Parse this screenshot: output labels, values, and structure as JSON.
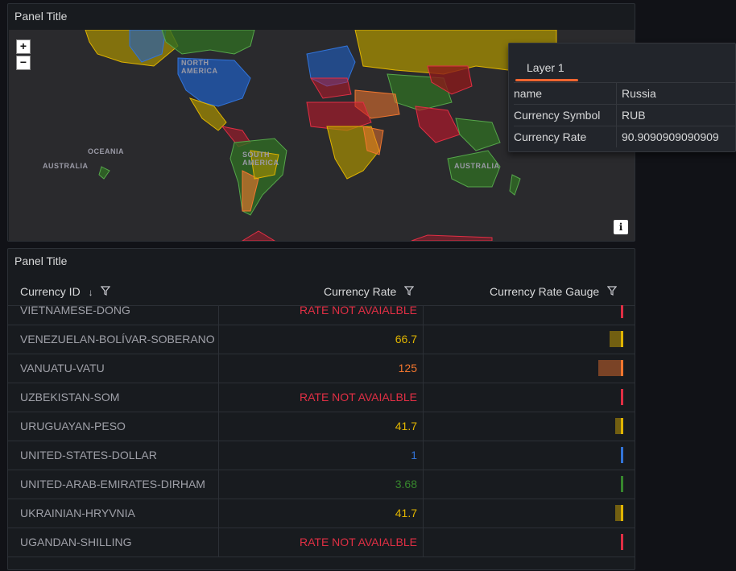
{
  "map_panel": {
    "title": "Panel Title",
    "zoom_in_label": "+",
    "zoom_out_label": "−",
    "info_label": "i",
    "region_labels": {
      "north_america": "NORTH\nAMERICA",
      "oceania": "OCEANIA",
      "australia_left": "AUSTRALIA",
      "south_america": "SOUTH\nAMERICA",
      "australia_right": "AUSTRALIA"
    }
  },
  "tooltip": {
    "tab_label": "Layer 1",
    "rows": [
      {
        "key": "name",
        "value": "Russia"
      },
      {
        "key": "Currency Symbol",
        "value": "RUB"
      },
      {
        "key": "Currency Rate",
        "value": "90.9090909090909"
      }
    ]
  },
  "table_panel": {
    "title": "Panel Title",
    "columns": [
      {
        "label": "Currency ID",
        "sort_icon": "arrow-down-icon",
        "filter_icon": "filter-icon"
      },
      {
        "label": "Currency Rate",
        "filter_icon": "filter-icon"
      },
      {
        "label": "Currency Rate Gauge",
        "filter_icon": "filter-icon"
      }
    ],
    "rows": [
      {
        "id": "VIETNAMESE-DONG",
        "rate": "RATE NOT AVAIALBLE",
        "color": "#e02f44",
        "gauge": 0
      },
      {
        "id": "VENEZUELAN-BOLÍVAR-SOBERANO",
        "rate": "66.7",
        "color": "#e0b400",
        "gauge": 0.12
      },
      {
        "id": "VANUATU-VATU",
        "rate": "125",
        "color": "#f2762e",
        "gauge": 0.23
      },
      {
        "id": "UZBEKISTAN-SOM",
        "rate": "RATE NOT AVAIALBLE",
        "color": "#e02f44",
        "gauge": 0
      },
      {
        "id": "URUGUAYAN-PESO",
        "rate": "41.7",
        "color": "#e0b400",
        "gauge": 0.07
      },
      {
        "id": "UNITED-STATES-DOLLAR",
        "rate": "1",
        "color": "#3274d9",
        "gauge": 0.01
      },
      {
        "id": "UNITED-ARAB-EMIRATES-DIRHAM",
        "rate": "3.68",
        "color": "#37872d",
        "gauge": 0.01
      },
      {
        "id": "UKRAINIAN-HRYVNIA",
        "rate": "41.7",
        "color": "#e0b400",
        "gauge": 0.07
      },
      {
        "id": "UGANDAN-SHILLING",
        "rate": "RATE NOT AVAIALBLE",
        "color": "#e02f44",
        "gauge": 0
      }
    ]
  },
  "colors": {
    "red": "#e02f44",
    "yellow": "#e0b400",
    "orange": "#f2762e",
    "blue": "#3274d9",
    "green": "#37872d",
    "accent": "#f06530"
  }
}
